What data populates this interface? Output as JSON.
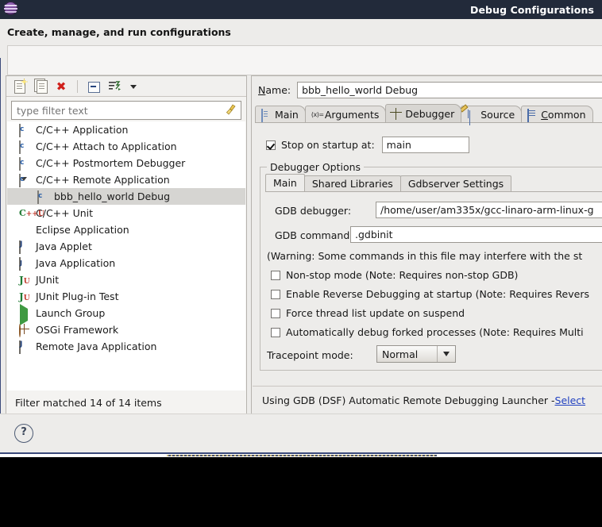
{
  "window": {
    "title": "Debug Configurations",
    "icon": "eclipse-icon",
    "header_title": "Create, manage, and run configurations"
  },
  "toolbar": {
    "buttons": [
      {
        "name": "new-launch-configuration",
        "icon": "new-config-icon"
      },
      {
        "name": "duplicate-launch-configuration",
        "icon": "duplicate-icon"
      },
      {
        "name": "delete-launch-configuration",
        "icon": "delete-icon",
        "glyph": "✖"
      },
      {
        "name": "collapse-all",
        "icon": "collapse-all-icon"
      },
      {
        "name": "filter-launch-configurations",
        "icon": "filter-icon"
      },
      {
        "name": "view-menu",
        "icon": "chevron-down-icon"
      }
    ]
  },
  "filter": {
    "placeholder": "type filter text",
    "value": "",
    "clear_icon": "broom-icon"
  },
  "tree": {
    "items": [
      {
        "label": "C/C++ Application",
        "icon": "c-app-icon",
        "indent": 0,
        "selected": false,
        "expandable": false
      },
      {
        "label": "C/C++ Attach to Application",
        "icon": "c-app-icon",
        "indent": 0,
        "selected": false,
        "expandable": false
      },
      {
        "label": "C/C++ Postmortem Debugger",
        "icon": "c-app-icon",
        "indent": 0,
        "selected": false,
        "expandable": false
      },
      {
        "label": "C/C++ Remote Application",
        "icon": "c-app-icon",
        "indent": 0,
        "selected": false,
        "expandable": true,
        "expanded": true
      },
      {
        "label": "bbb_hello_world Debug",
        "icon": "c-app-icon",
        "indent": 1,
        "selected": true,
        "expandable": false
      },
      {
        "label": "C/C++ Unit",
        "icon": "cpp-unit-icon",
        "indent": 0,
        "selected": false,
        "expandable": false
      },
      {
        "label": "Eclipse Application",
        "icon": "eclipse-icon",
        "indent": 0,
        "selected": false,
        "expandable": false
      },
      {
        "label": "Java Applet",
        "icon": "java-applet-icon",
        "indent": 0,
        "selected": false,
        "expandable": false
      },
      {
        "label": "Java Application",
        "icon": "java-application-icon",
        "indent": 0,
        "selected": false,
        "expandable": false
      },
      {
        "label": "JUnit",
        "icon": "junit-icon",
        "indent": 0,
        "selected": false,
        "expandable": false
      },
      {
        "label": "JUnit Plug-in Test",
        "icon": "junit-plugin-icon",
        "indent": 0,
        "selected": false,
        "expandable": false
      },
      {
        "label": "Launch Group",
        "icon": "launch-group-icon",
        "indent": 0,
        "selected": false,
        "expandable": false
      },
      {
        "label": "OSGi Framework",
        "icon": "osgi-icon",
        "indent": 0,
        "selected": false,
        "expandable": false
      },
      {
        "label": "Remote Java Application",
        "icon": "remote-java-icon",
        "indent": 0,
        "selected": false,
        "expandable": false
      }
    ],
    "status": "Filter matched 14 of 14 items"
  },
  "config": {
    "name_label": "Name:",
    "name_value": "bbb_hello_world Debug",
    "tabs": [
      {
        "label": "Main",
        "icon": "document-icon",
        "active": false
      },
      {
        "label": "Arguments",
        "icon": "arguments-icon",
        "active": false
      },
      {
        "label": "Debugger",
        "icon": "bug-icon",
        "active": true
      },
      {
        "label": "Source",
        "icon": "source-icon",
        "active": false
      },
      {
        "label": "Common",
        "icon": "common-icon",
        "active": false
      }
    ],
    "stop_on_startup": {
      "label": "Stop on startup at:",
      "checked": true,
      "value": "main"
    },
    "debugger_options": {
      "group_title": "Debugger Options",
      "tabs": [
        {
          "label": "Main",
          "active": true
        },
        {
          "label": "Shared Libraries",
          "active": false
        },
        {
          "label": "Gdbserver Settings",
          "active": false
        }
      ],
      "gdb_debugger_label": "GDB debugger:",
      "gdb_debugger_value": "/home/user/am335x/gcc-linaro-arm-linux-g",
      "gdb_command_file_label": "GDB command file:",
      "gdb_command_file_value": ".gdbinit",
      "warning_text": "(Warning: Some commands in this file may interfere with the st",
      "checkboxes": [
        {
          "label": "Non-stop mode (Note: Requires non-stop GDB)",
          "checked": false
        },
        {
          "label": "Enable Reverse Debugging at startup (Note: Requires Revers",
          "checked": false
        },
        {
          "label": "Force thread list update on suspend",
          "checked": false
        },
        {
          "label": "Automatically debug forked processes (Note: Requires Multi",
          "checked": false
        }
      ],
      "tracepoint_label": "Tracepoint mode:",
      "tracepoint_value": "Normal"
    },
    "launcher_text": "Using GDB (DSF) Automatic Remote Debugging Launcher - ",
    "launcher_link": "Select "
  },
  "footer": {
    "help_label": "?",
    "help_name": "help-button"
  },
  "colors": {
    "titlebar_bg": "#222a3a",
    "dialog_bg": "#edecea",
    "selection_bg": "#d6d5d2",
    "link": "#2040c0",
    "delete_red": "#d0201b"
  }
}
